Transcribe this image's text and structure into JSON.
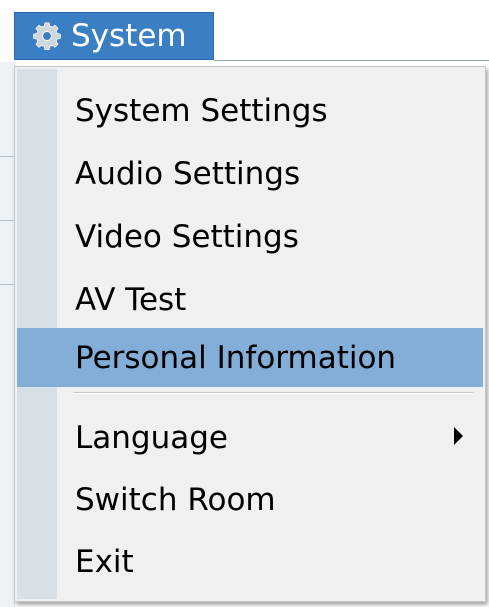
{
  "menubar": {
    "menu_label": "System",
    "menu_icon": "gear-icon"
  },
  "dropdown": {
    "items": [
      {
        "label": "System Settings"
      },
      {
        "label": "Audio Settings"
      },
      {
        "label": "Video Settings"
      },
      {
        "label": "AV Test"
      },
      {
        "label": "Personal Information",
        "highlighted": true
      },
      {
        "label": "Language",
        "has_submenu": true
      },
      {
        "label": "Switch Room"
      },
      {
        "label": "Exit"
      }
    ]
  },
  "colors": {
    "menu_active_bg": "#3a7ec3",
    "item_highlight_bg": "#82aed8",
    "menu_bg": "#f0f0f0",
    "gutter_bg": "#d8e0e6"
  }
}
